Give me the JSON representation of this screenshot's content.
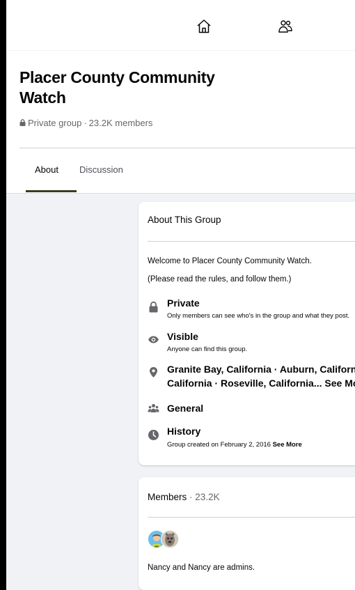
{
  "nav": {
    "home_icon": "home-icon",
    "groups_icon": "people-icon"
  },
  "group": {
    "name": "Placer County Community Watch",
    "privacy": "Private group",
    "separator": "·",
    "members": "23.2K members"
  },
  "tabs": [
    {
      "label": "About",
      "active": true
    },
    {
      "label": "Discussion",
      "active": false
    }
  ],
  "about": {
    "title": "About This Group",
    "description_line1": "Welcome to Placer County Community Watch.",
    "description_line2": "(Please read the rules, and follow them.)",
    "rows": [
      {
        "icon": "lock-icon",
        "title": "Private",
        "subtitle": "Only members can see who's in the group and what they post."
      },
      {
        "icon": "eye-icon",
        "title": "Visible",
        "subtitle": "Anyone can find this group."
      },
      {
        "icon": "location-pin-icon",
        "title_line1": "Granite Bay, California · Auburn, California ·",
        "title_line2": "California · Roseville, California...",
        "see_more": "See More"
      },
      {
        "icon": "people-group-icon",
        "title": "General"
      },
      {
        "icon": "clock-icon",
        "title": "History",
        "subtitle": "Group created on February 2, 2016",
        "see_more": "See More"
      }
    ]
  },
  "members_card": {
    "title": "Members",
    "separator": "·",
    "count": "23.2K",
    "admins_text": "Nancy and Nancy are admins."
  },
  "colors": {
    "tab_underline": "#3a3b21",
    "page_bg": "#f0f2f5",
    "icon_gray": "#65676b"
  }
}
